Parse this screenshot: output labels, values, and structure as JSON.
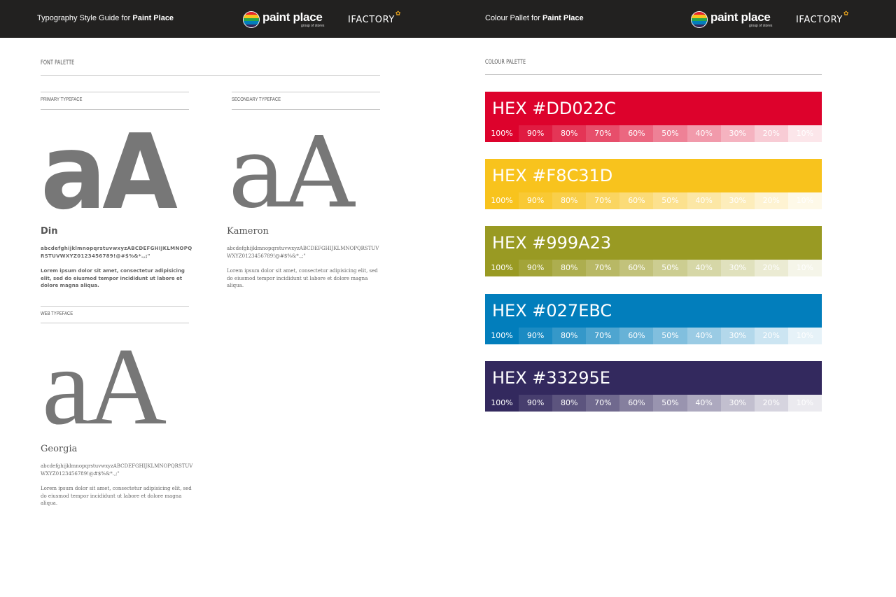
{
  "header": {
    "left_title_prefix": "Typography Style Guide for",
    "left_title_brand": "Paint Place",
    "right_title_prefix": "Colour Pallet for",
    "right_title_brand": "Paint Place",
    "logo_text": "paint place",
    "logo_subtext": "group of stores",
    "agency_text": "IFACTORY",
    "logo_stripes": [
      "#e8262b",
      "#f8c31d",
      "#2aa84a",
      "#027ebc",
      "#33295e"
    ]
  },
  "typography": {
    "section_title": "FONT PALETTE",
    "primary": {
      "label": "PRIMARY TYPEFACE",
      "sample": "aA",
      "name": "Din",
      "alphabet": "abcdefghijklmnopqrstuvwxyzABCDEFGHIJKLMNOPQRSTUVWXYZ0123456789!@#$%&*.,;\"",
      "lorem": "Lorem ipsum dolor sit amet, consectetur adipisicing elit, sed do eiusmod tempor incididunt ut labore et dolore magna aliqua."
    },
    "secondary": {
      "label": "SECONDARY TYPEFACE",
      "sample": "aA",
      "name": "Kameron",
      "alphabet": "abcdefghijklmnopqrstuvwxyzABCDEFGHIJKLMNOPQRSTUVWXYZ0123456789!@#$%&*.,;\"",
      "lorem": "Lorem ipsum dolor sit amet, consectetur adipisicing elit, sed do eiusmod tempor incididunt ut labore et dolore magna aliqua."
    },
    "web": {
      "label": "WEB TYPEFACE",
      "sample": "aA",
      "name": "Georgia",
      "alphabet": "abcdefghijklmnopqrstuvwxyzABCDEFGHIJKLMNOPQRSTUVWXYZ0123456789!@#$%&*.,;\"",
      "lorem": "Lorem ipsum dolor sit amet, consectetur adipisicing elit, sed do eiusmod tempor incididunt ut labore et dolore magna aliqua."
    }
  },
  "colours": {
    "section_title": "COLOUR PALETTE",
    "tint_labels": [
      "100%",
      "90%",
      "80%",
      "70%",
      "60%",
      "50%",
      "40%",
      "30%",
      "20%",
      "10%"
    ],
    "tint_levels": [
      1.0,
      0.9,
      0.8,
      0.7,
      0.6,
      0.5,
      0.4,
      0.3,
      0.2,
      0.1
    ],
    "swatches": [
      {
        "label": "HEX #DD022C",
        "color": "#DD022C"
      },
      {
        "label": "HEX #F8C31D",
        "color": "#F8C31D"
      },
      {
        "label": "HEX #999A23",
        "color": "#999A23"
      },
      {
        "label": "HEX #027EBC",
        "color": "#027EBC"
      },
      {
        "label": "HEX #33295E",
        "color": "#33295E"
      }
    ]
  }
}
